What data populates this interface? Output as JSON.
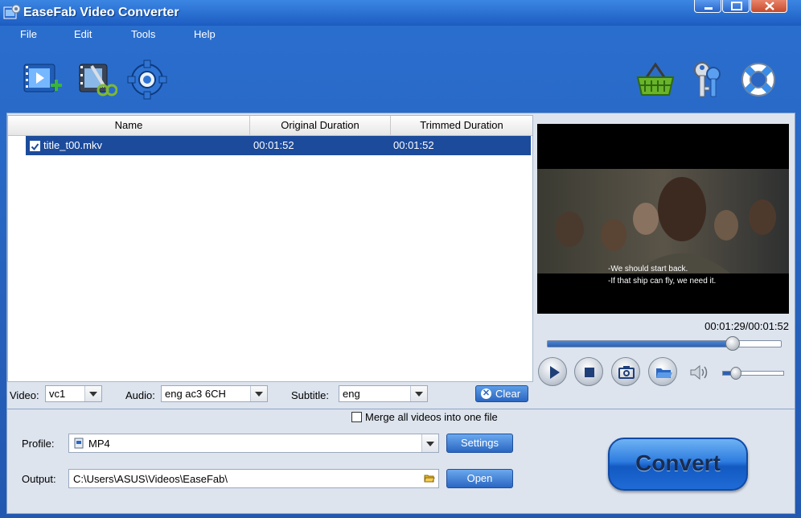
{
  "window": {
    "title": "EaseFab Video Converter"
  },
  "menu": {
    "items": [
      "File",
      "Edit",
      "Tools",
      "Help"
    ]
  },
  "toolbar": {
    "left_icons": [
      "add-video-icon",
      "edit-video-icon",
      "settings-gear-icon"
    ],
    "right_icons": [
      "basket-icon",
      "keys-icon",
      "lifebuoy-icon"
    ]
  },
  "file_list": {
    "columns": [
      "Name",
      "Original Duration",
      "Trimmed Duration"
    ],
    "rows": [
      {
        "checked": true,
        "name": "title_t00.mkv",
        "original": "00:01:52",
        "trimmed": "00:01:52"
      }
    ]
  },
  "tracks": {
    "video_label": "Video:",
    "video_value": "vc1",
    "audio_label": "Audio:",
    "audio_value": "eng ac3 6CH",
    "subtitle_label": "Subtitle:",
    "subtitle_value": "eng",
    "clear_label": "Clear"
  },
  "preview": {
    "subtitle_line1": "-We should start back.",
    "subtitle_line2": "-If that ship can fly, we need it.",
    "time": "00:01:29/00:01:52",
    "progress": 0.79,
    "volume": 0.2
  },
  "merge": {
    "label": "Merge all videos into one file",
    "checked": false
  },
  "profile": {
    "label": "Profile:",
    "value": "MP4",
    "button": "Settings"
  },
  "output": {
    "label": "Output:",
    "value": "C:\\Users\\ASUS\\Videos\\EaseFab\\",
    "button": "Open"
  },
  "convert": {
    "label": "Convert"
  },
  "colors": {
    "accent": "#2258b0",
    "selection": "#1c4b9c",
    "button": "#2a66c2"
  }
}
